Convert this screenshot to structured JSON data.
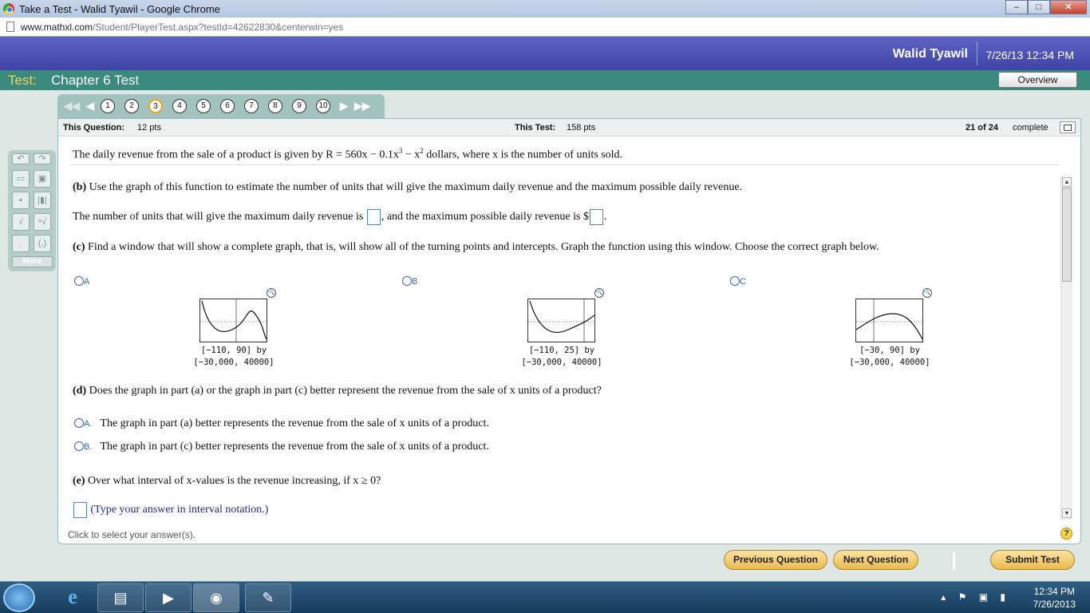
{
  "browser": {
    "tab_title": "Take a Test - Walid Tyawil - Google Chrome",
    "url_domain": "www.mathxl.com",
    "url_path": "/Student/PlayerTest.aspx?testId=42622830&centerwin=yes"
  },
  "header": {
    "user_name": "Walid Tyawil",
    "datetime": "7/26/13 12:34 PM"
  },
  "test": {
    "label": "Test:",
    "name": "Chapter 6 Test",
    "overview_label": "Overview"
  },
  "nav": {
    "questions": [
      "1",
      "2",
      "3",
      "4",
      "5",
      "6",
      "7",
      "8",
      "9",
      "10"
    ],
    "current": "3"
  },
  "status": {
    "this_question_label": "This Question:",
    "this_question_pts": "12 pts",
    "this_test_label": "This Test:",
    "this_test_pts": "158 pts",
    "progress": "21 of 24",
    "complete_label": "complete"
  },
  "tools": {
    "more_label": "More"
  },
  "question": {
    "intro_pre": "The daily revenue from the sale of a product is given by R = 560x − 0.1x",
    "intro_exp1": "3",
    "intro_mid": " − x",
    "intro_exp2": "2",
    "intro_post": " dollars, where x is the number of units sold.",
    "part_b_tag": "(b)",
    "part_b": " Use the graph of this function to estimate the number of units that will give the maximum daily revenue and the maximum possible daily revenue.",
    "part_b_ans_pre": "The number of units that will give the maximum daily revenue is ",
    "part_b_ans_mid": ", and the maximum possible daily revenue is $",
    "part_b_ans_post": ".",
    "part_c_tag": "(c)",
    "part_c": " Find a window that will show a complete graph, that is, will show all of the turning points and intercepts. Graph the function using this window. Choose the correct graph below.",
    "graph_options": [
      {
        "letter": "A",
        "window_line1": "[−110, 90] by",
        "window_line2": "[−30,000, 40000]"
      },
      {
        "letter": "B",
        "window_line1": "[−110, 25] by",
        "window_line2": "[−30,000, 40000]"
      },
      {
        "letter": "C",
        "window_line1": "[−30, 90] by",
        "window_line2": "[−30,000, 40000]"
      }
    ],
    "part_d_tag": "(d)",
    "part_d": " Does the graph in part (a) or the graph in part (c) better represent the revenue from the sale of x units of a product?",
    "part_d_options": [
      {
        "letter": "A.",
        "text": "The graph in part (a) better represents the revenue from the sale of x units of a product."
      },
      {
        "letter": "B.",
        "text": "The graph in part (c) better represents the revenue from the sale of x units of a product."
      }
    ],
    "part_e_tag": "(e)",
    "part_e": " Over what interval of x-values is the revenue increasing, if x ≥ 0?",
    "part_e_hint": "(Type your answer in interval notation.)"
  },
  "footer": {
    "hint": "Click to select your answer(s).",
    "help": "?",
    "prev_label": "Previous Question",
    "next_label": "Next Question",
    "submit_label": "Submit Test"
  },
  "taskbar": {
    "time": "12:34 PM",
    "date": "7/26/2013"
  }
}
